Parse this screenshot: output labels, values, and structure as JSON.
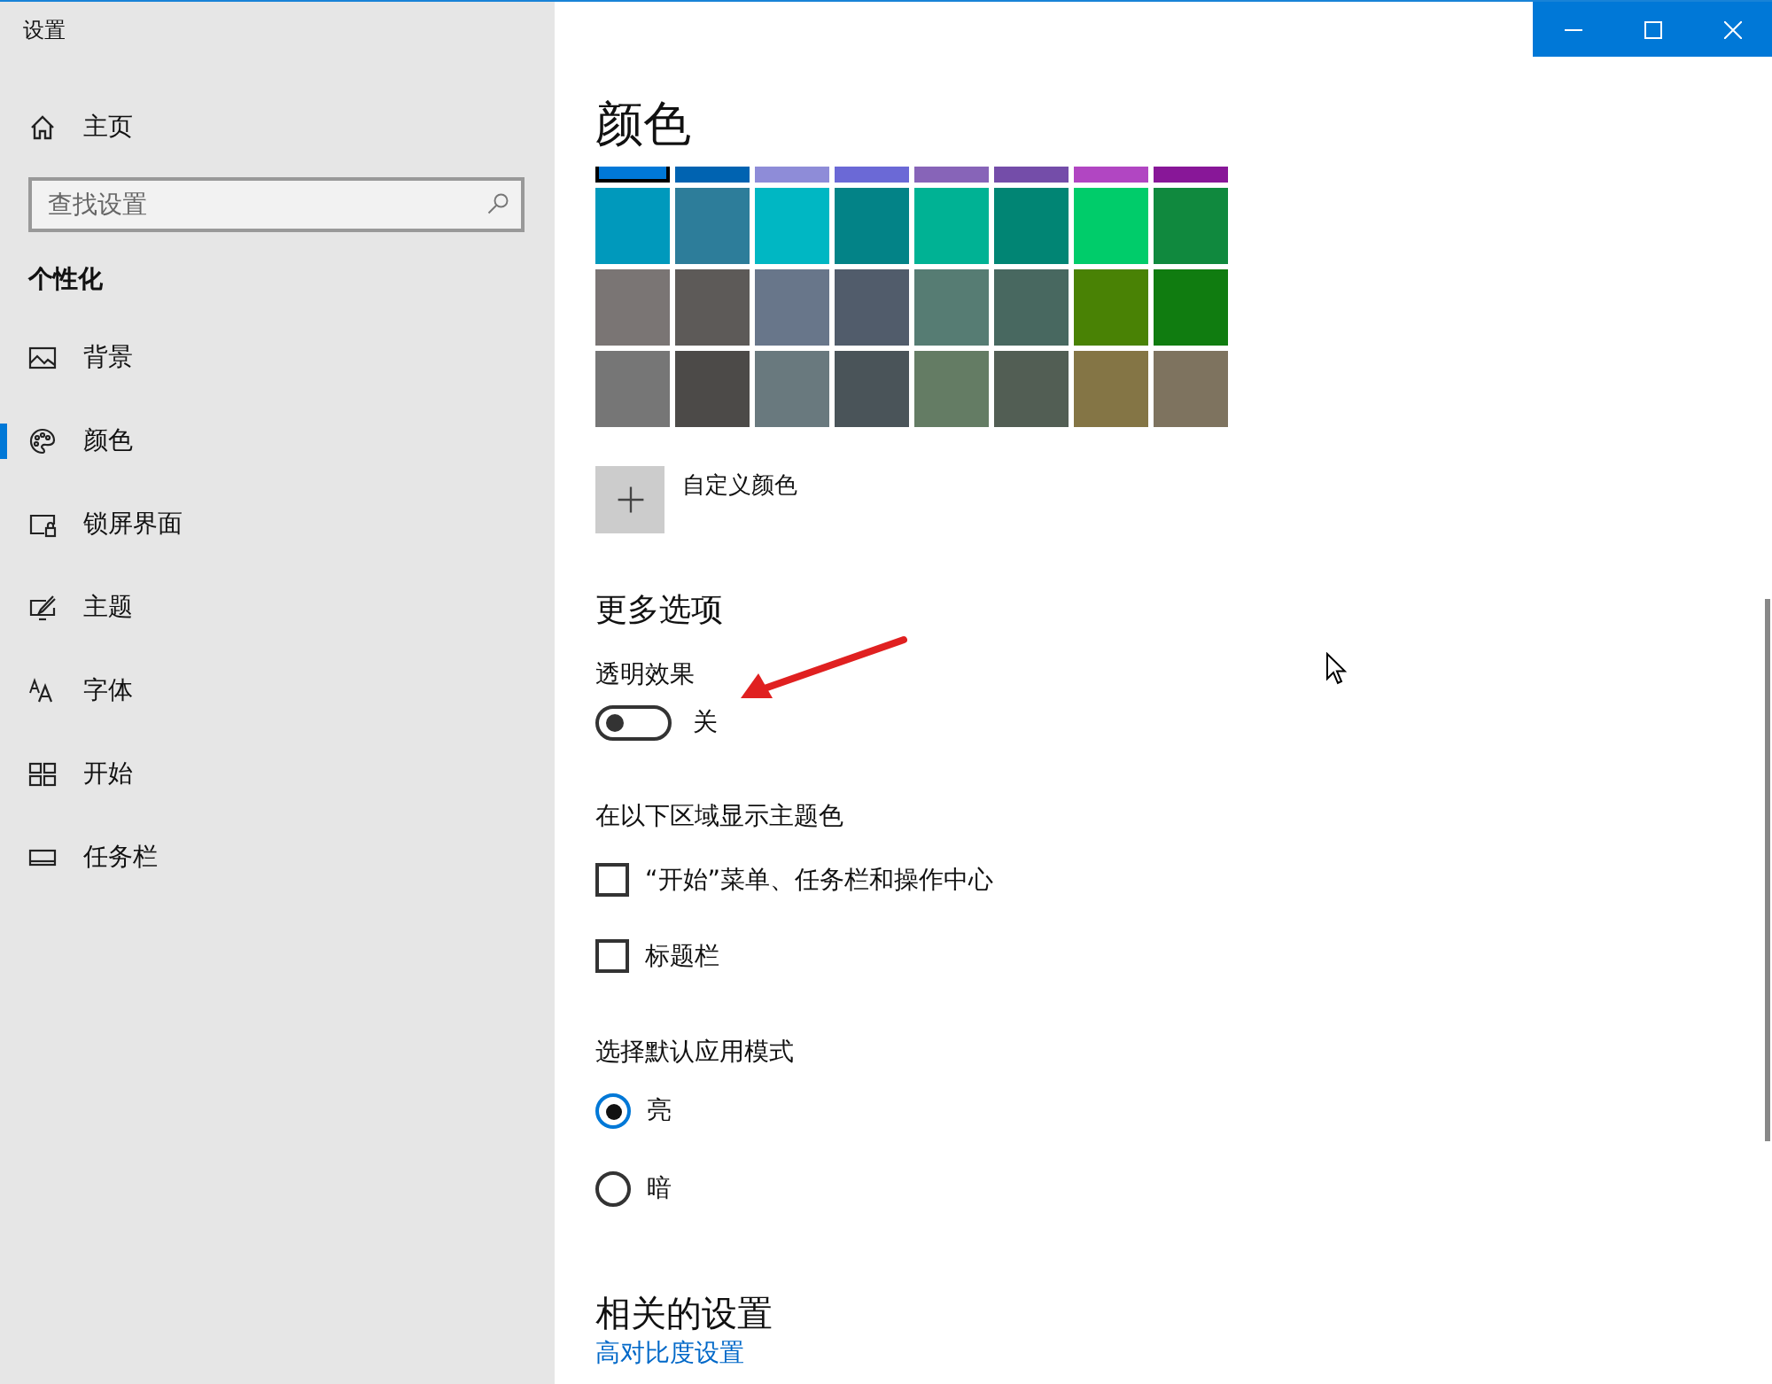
{
  "window": {
    "title": "设置"
  },
  "sidebar": {
    "home": "主页",
    "search": {
      "placeholder": "查找设置"
    },
    "section": "个性化",
    "items": [
      {
        "label": "背景",
        "selected": false
      },
      {
        "label": "颜色",
        "selected": true
      },
      {
        "label": "锁屏界面",
        "selected": false
      },
      {
        "label": "主题",
        "selected": false
      },
      {
        "label": "字体",
        "selected": false
      },
      {
        "label": "开始",
        "selected": false
      },
      {
        "label": "任务栏",
        "selected": false
      }
    ]
  },
  "content": {
    "title": "颜色",
    "swatch_rows": [
      {
        "swatches": [
          {
            "color": "#0078d7",
            "selected": true
          },
          {
            "color": "#0063b1",
            "selected": false
          },
          {
            "color": "#8e8cd8",
            "selected": false
          },
          {
            "color": "#6b69d6",
            "selected": false
          },
          {
            "color": "#8764b8",
            "selected": false
          },
          {
            "color": "#744da9",
            "selected": false
          },
          {
            "color": "#b146c2",
            "selected": false
          },
          {
            "color": "#881798",
            "selected": false
          }
        ]
      },
      {
        "swatches": [
          {
            "color": "#0099bc",
            "selected": false
          },
          {
            "color": "#2d7d9a",
            "selected": false
          },
          {
            "color": "#00b7c3",
            "selected": false
          },
          {
            "color": "#038387",
            "selected": false
          },
          {
            "color": "#00b294",
            "selected": false
          },
          {
            "color": "#018574",
            "selected": false
          },
          {
            "color": "#00cc6a",
            "selected": false
          },
          {
            "color": "#10893e",
            "selected": false
          }
        ]
      },
      {
        "swatches": [
          {
            "color": "#7a7574",
            "selected": false
          },
          {
            "color": "#5d5a58",
            "selected": false
          },
          {
            "color": "#68768a",
            "selected": false
          },
          {
            "color": "#515c6b",
            "selected": false
          },
          {
            "color": "#567c73",
            "selected": false
          },
          {
            "color": "#486860",
            "selected": false
          },
          {
            "color": "#498205",
            "selected": false
          },
          {
            "color": "#107c10",
            "selected": false
          }
        ]
      },
      {
        "swatches": [
          {
            "color": "#767676",
            "selected": false
          },
          {
            "color": "#4c4a48",
            "selected": false
          },
          {
            "color": "#69797e",
            "selected": false
          },
          {
            "color": "#4a5459",
            "selected": false
          },
          {
            "color": "#647c64",
            "selected": false
          },
          {
            "color": "#525e54",
            "selected": false
          },
          {
            "color": "#847545",
            "selected": false
          },
          {
            "color": "#7e735f",
            "selected": false
          }
        ]
      }
    ],
    "custom_color": "自定义颜色",
    "more_options": "更多选项",
    "transparency": {
      "label": "透明效果",
      "on": false,
      "state_text": "关"
    },
    "accent_surfaces": {
      "label": "在以下区域显示主题色",
      "options": [
        {
          "label": "“开始”菜单、任务栏和操作中心",
          "checked": false
        },
        {
          "label": "标题栏",
          "checked": false
        }
      ]
    },
    "app_mode": {
      "label": "选择默认应用模式",
      "options": [
        {
          "label": "亮",
          "selected": true
        },
        {
          "label": "暗",
          "selected": false
        }
      ]
    },
    "related": {
      "title": "相关的设置",
      "links": [
        "高对比度设置"
      ]
    }
  }
}
